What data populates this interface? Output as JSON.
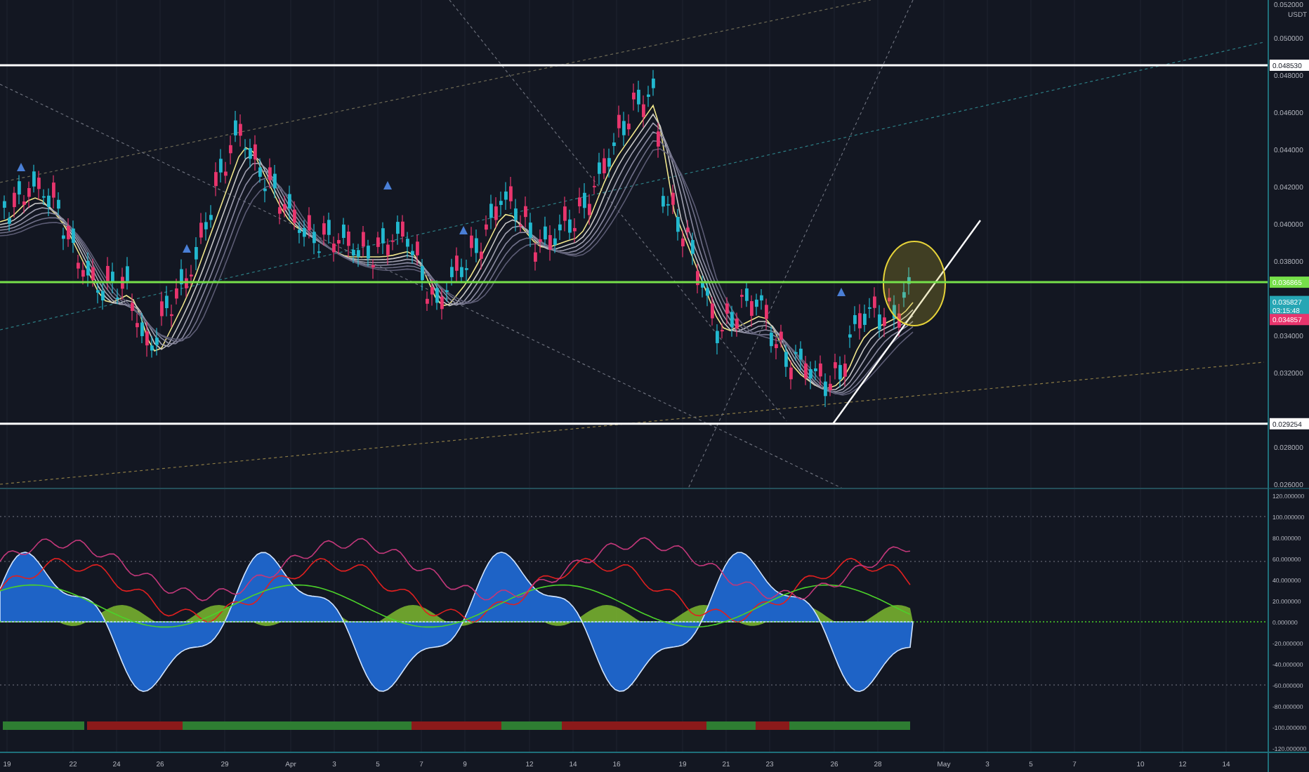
{
  "price_axis": {
    "quote": "USDT",
    "ticks": [
      "0.052000",
      "0.050000",
      "0.048000",
      "0.046000",
      "0.044000",
      "0.042000",
      "0.040000",
      "0.038000",
      "0.034000",
      "0.032000",
      "0.028000",
      "0.026000"
    ]
  },
  "price_tags": [
    {
      "kind": "level",
      "label": "0.048530",
      "color": "#ffffff"
    },
    {
      "kind": "level",
      "label": "0.036865",
      "color": "#76e04a"
    },
    {
      "kind": "price",
      "label": "0.035827",
      "sublabel": "03:15:48",
      "color": "#26a6b4"
    },
    {
      "kind": "price",
      "label": "0.034857",
      "color": "#e8356d"
    },
    {
      "kind": "level",
      "label": "0.029254",
      "color": "#ffffff"
    }
  ],
  "oscillator_axis": {
    "ticks": [
      "120.000000",
      "100.000000",
      "80.000000",
      "60.000000",
      "40.000000",
      "20.000000",
      "0.000000",
      "-20.000000",
      "-40.000000",
      "-60.000000",
      "-80.000000",
      "-100.000000",
      "-120.000000"
    ]
  },
  "trend_strip": [
    {
      "color": "#2e7d32"
    },
    {
      "color": "#8b1a1a"
    },
    {
      "color": "#2e7d32"
    },
    {
      "color": "#8b1a1a"
    },
    {
      "color": "#2e7d32"
    },
    {
      "color": "#8b1a1a"
    },
    {
      "color": "#2e7d32"
    },
    {
      "color": "#8b1a1a"
    },
    {
      "color": "#2e7d32"
    }
  ],
  "time_axis": {
    "labels": [
      "19",
      "22",
      "24",
      "26",
      "29",
      "Apr",
      "3",
      "5",
      "7",
      "9",
      "12",
      "14",
      "16",
      "19",
      "21",
      "23",
      "26",
      "28",
      "May",
      "3",
      "5",
      "7",
      "10",
      "12",
      "14"
    ]
  }
}
